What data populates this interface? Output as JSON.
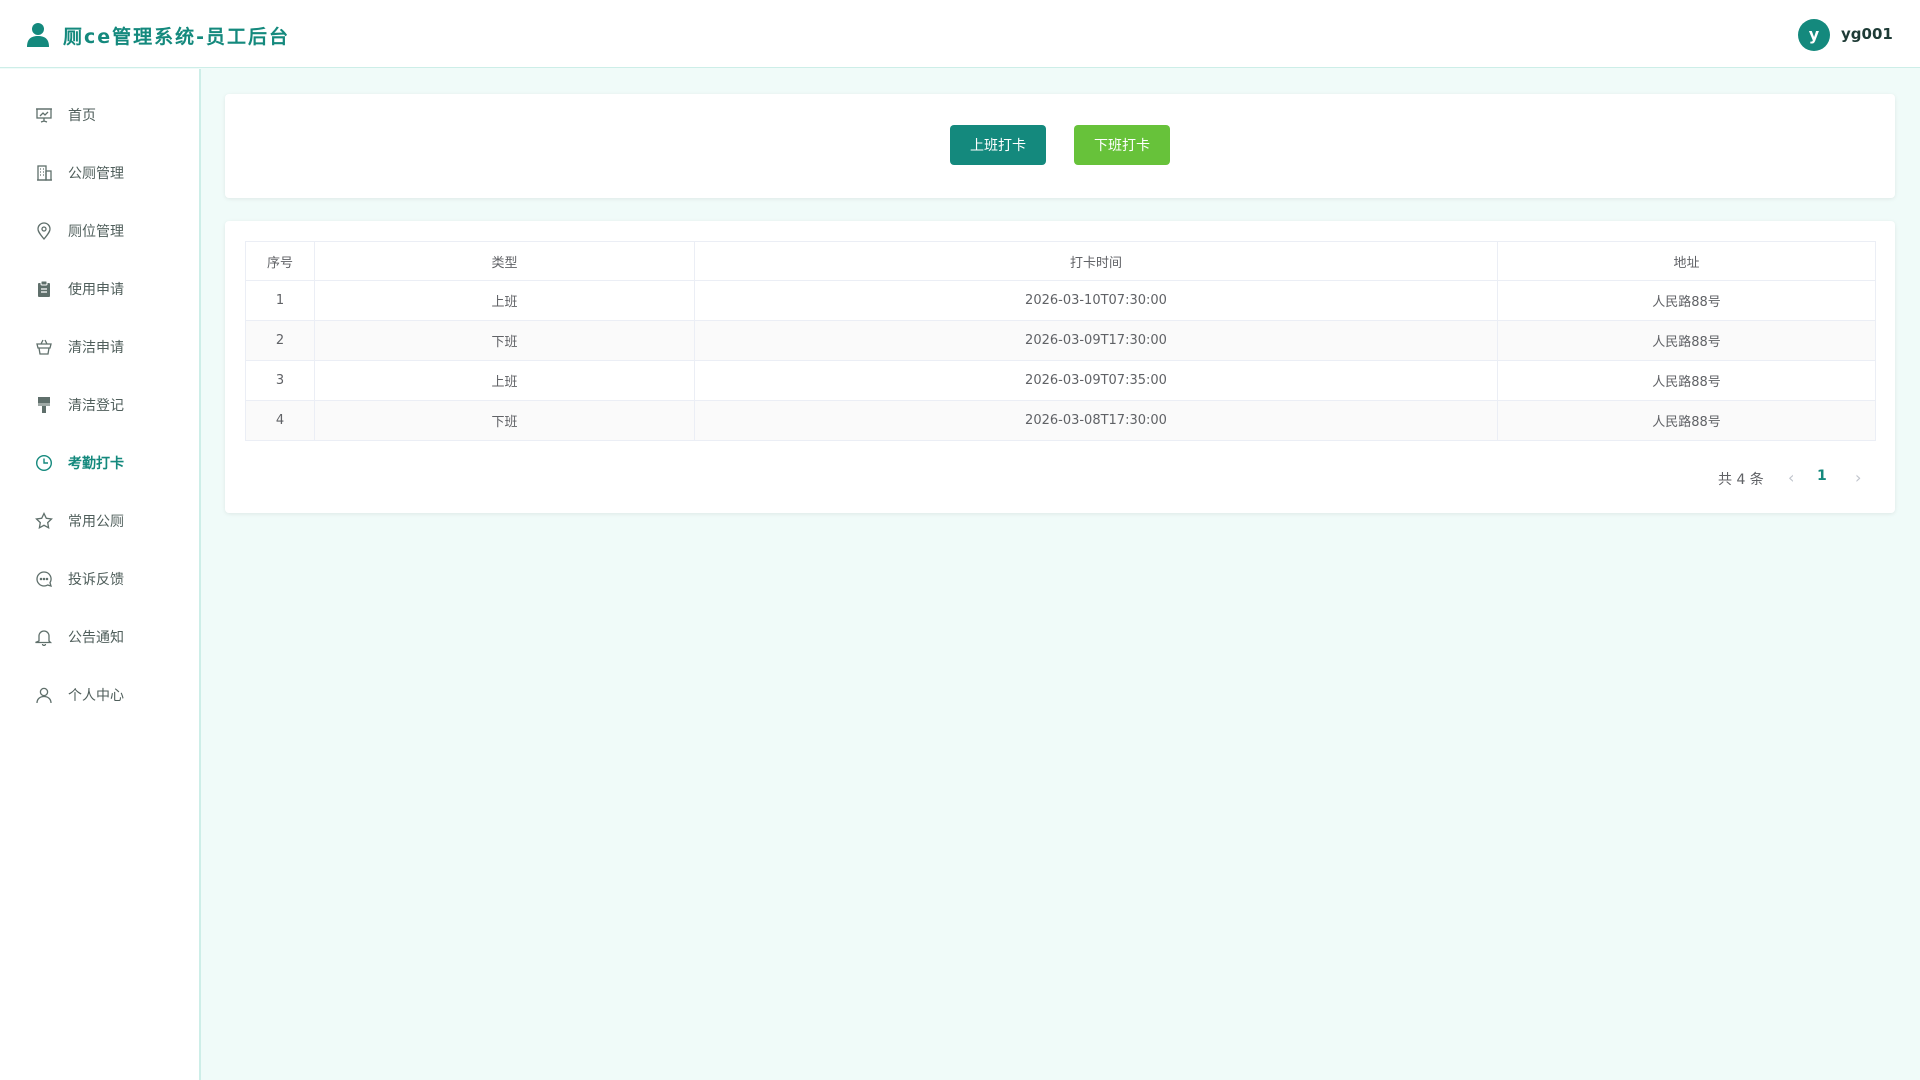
{
  "header": {
    "title": "厕ce管理系统-员工后台",
    "avatar_letter": "y",
    "username": "yg001"
  },
  "sidebar": {
    "items": [
      {
        "label": "首页",
        "icon": "presentation-icon"
      },
      {
        "label": "公厕管理",
        "icon": "building-icon"
      },
      {
        "label": "厕位管理",
        "icon": "location-pin-icon"
      },
      {
        "label": "使用申请",
        "icon": "clipboard-icon"
      },
      {
        "label": "清洁申请",
        "icon": "basket-icon"
      },
      {
        "label": "清洁登记",
        "icon": "paint-brush-icon"
      },
      {
        "label": "考勤打卡",
        "icon": "clock-icon",
        "active": true
      },
      {
        "label": "常用公厕",
        "icon": "star-icon"
      },
      {
        "label": "投诉反馈",
        "icon": "chat-bubble-icon"
      },
      {
        "label": "公告通知",
        "icon": "bell-icon"
      },
      {
        "label": "个人中心",
        "icon": "user-icon"
      }
    ]
  },
  "actions": {
    "clock_in_label": "上班打卡",
    "clock_out_label": "下班打卡"
  },
  "table": {
    "columns": [
      "序号",
      "类型",
      "打卡时间",
      "地址"
    ],
    "rows": [
      [
        "1",
        "上班",
        "2026-03-10T07:30:00",
        "人民路88号"
      ],
      [
        "2",
        "下班",
        "2026-03-09T17:30:00",
        "人民路88号"
      ],
      [
        "3",
        "上班",
        "2026-03-09T07:35:00",
        "人民路88号"
      ],
      [
        "4",
        "下班",
        "2026-03-08T17:30:00",
        "人民路88号"
      ]
    ]
  },
  "pagination": {
    "total_text": "共 4 条",
    "current_page": "1",
    "prev_symbol": "‹",
    "next_symbol": "›"
  },
  "colors": {
    "brand": "#14897d",
    "clock_out": "#67c23a",
    "background": "#f0fbf9"
  }
}
